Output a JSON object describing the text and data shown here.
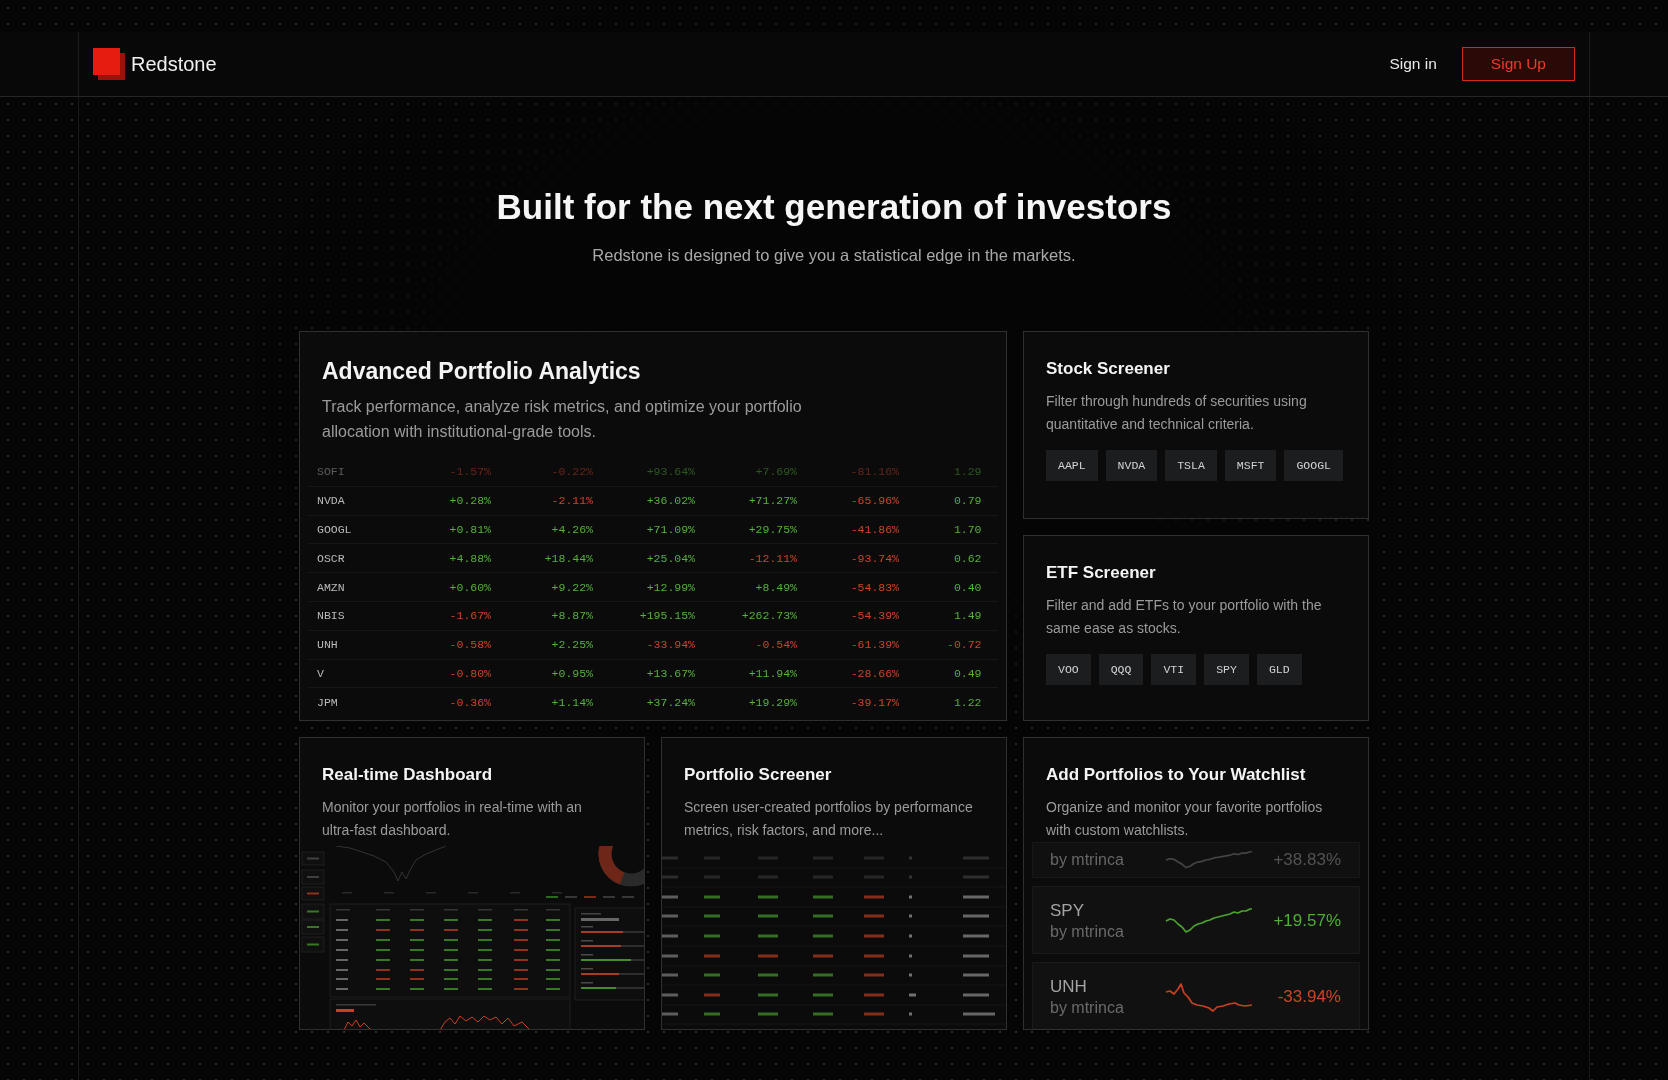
{
  "header": {
    "brand": "Redstone",
    "sign_in": "Sign in",
    "sign_up": "Sign Up"
  },
  "hero": {
    "title": "Built for the next generation of investors",
    "subtitle": "Redstone is designed to give you a statistical edge in the markets."
  },
  "features": [
    {
      "kind": "table",
      "title": "Advanced Portfolio Analytics",
      "description": "Track performance, analyze risk metrics, and optimize your portfolio allocation with institutional-grade tools.",
      "table": {
        "rows": [
          {
            "ticker": "SOFI",
            "values": [
              {
                "text": "-1.57%",
                "kind": "down"
              },
              {
                "text": "-0.22%",
                "kind": "down"
              },
              {
                "text": "+93.64%",
                "kind": "up"
              },
              {
                "text": "+7.69%",
                "kind": "up"
              },
              {
                "text": "-81.16%",
                "kind": "down"
              },
              {
                "text": "1.29",
                "kind": "up"
              }
            ]
          },
          {
            "ticker": "NVDA",
            "values": [
              {
                "text": "+0.28%",
                "kind": "up"
              },
              {
                "text": "-2.11%",
                "kind": "down"
              },
              {
                "text": "+36.02%",
                "kind": "up"
              },
              {
                "text": "+71.27%",
                "kind": "up"
              },
              {
                "text": "-65.96%",
                "kind": "down"
              },
              {
                "text": "0.79",
                "kind": "up"
              }
            ]
          },
          {
            "ticker": "GOOGL",
            "values": [
              {
                "text": "+0.81%",
                "kind": "up"
              },
              {
                "text": "+4.26%",
                "kind": "up"
              },
              {
                "text": "+71.09%",
                "kind": "up"
              },
              {
                "text": "+29.75%",
                "kind": "up"
              },
              {
                "text": "-41.86%",
                "kind": "down"
              },
              {
                "text": "1.70",
                "kind": "up"
              }
            ]
          },
          {
            "ticker": "OSCR",
            "values": [
              {
                "text": "+4.88%",
                "kind": "up"
              },
              {
                "text": "+18.44%",
                "kind": "up"
              },
              {
                "text": "+25.04%",
                "kind": "up"
              },
              {
                "text": "-12.11%",
                "kind": "down"
              },
              {
                "text": "-93.74%",
                "kind": "down"
              },
              {
                "text": "0.62",
                "kind": "up"
              }
            ]
          },
          {
            "ticker": "AMZN",
            "values": [
              {
                "text": "+0.60%",
                "kind": "up"
              },
              {
                "text": "+9.22%",
                "kind": "up"
              },
              {
                "text": "+12.99%",
                "kind": "up"
              },
              {
                "text": "+8.49%",
                "kind": "up"
              },
              {
                "text": "-54.83%",
                "kind": "down"
              },
              {
                "text": "0.40",
                "kind": "up"
              }
            ]
          },
          {
            "ticker": "NBIS",
            "values": [
              {
                "text": "-1.67%",
                "kind": "down"
              },
              {
                "text": "+8.87%",
                "kind": "up"
              },
              {
                "text": "+195.15%",
                "kind": "up"
              },
              {
                "text": "+262.73%",
                "kind": "up"
              },
              {
                "text": "-54.39%",
                "kind": "down"
              },
              {
                "text": "1.49",
                "kind": "up"
              }
            ]
          },
          {
            "ticker": "UNH",
            "values": [
              {
                "text": "-0.58%",
                "kind": "down"
              },
              {
                "text": "+2.25%",
                "kind": "up"
              },
              {
                "text": "-33.94%",
                "kind": "down"
              },
              {
                "text": "-0.54%",
                "kind": "down"
              },
              {
                "text": "-61.39%",
                "kind": "down"
              },
              {
                "text": "-0.72",
                "kind": "down"
              }
            ]
          },
          {
            "ticker": "V",
            "values": [
              {
                "text": "-0.80%",
                "kind": "down"
              },
              {
                "text": "+0.95%",
                "kind": "up"
              },
              {
                "text": "+13.67%",
                "kind": "up"
              },
              {
                "text": "+11.94%",
                "kind": "up"
              },
              {
                "text": "-28.66%",
                "kind": "down"
              },
              {
                "text": "0.49",
                "kind": "up"
              }
            ]
          },
          {
            "ticker": "JPM",
            "values": [
              {
                "text": "-0.36%",
                "kind": "down"
              },
              {
                "text": "+1.14%",
                "kind": "up"
              },
              {
                "text": "+37.24%",
                "kind": "up"
              },
              {
                "text": "+19.29%",
                "kind": "up"
              },
              {
                "text": "-39.17%",
                "kind": "down"
              },
              {
                "text": "1.22",
                "kind": "up"
              }
            ]
          }
        ]
      }
    },
    {
      "kind": "chips",
      "title": "Stock Screener",
      "description": "Filter through hundreds of securities using quantitative and technical criteria.",
      "chips": [
        "AAPL",
        "NVDA",
        "TSLA",
        "MSFT",
        "GOOGL"
      ]
    },
    {
      "kind": "chips",
      "title": "ETF Screener",
      "description": "Filter and add ETFs to your portfolio with the same ease as stocks.",
      "chips": [
        "VOO",
        "QQQ",
        "VTI",
        "SPY",
        "GLD"
      ]
    },
    {
      "kind": "dashboard",
      "title": "Real-time Dashboard",
      "description": "Monitor your portfolios in real-time with an ultra-fast dashboard."
    },
    {
      "kind": "screener",
      "title": "Portfolio Screener",
      "description": "Screen user-created portfolios by performance metrics, risk factors, and more..."
    },
    {
      "kind": "watchlist",
      "title": "Add Portfolios to Your Watchlist",
      "description": "Organize and monitor your favorite portfolios with custom watchlists.",
      "items": [
        {
          "owner": "by mtrinca",
          "change": "+38.83%",
          "kind": "up"
        },
        {
          "name": "SPY",
          "owner": "by mtrinca",
          "change": "+19.57%",
          "kind": "up"
        },
        {
          "name": "UNH",
          "owner": "by mtrinca",
          "change": "-33.94%",
          "kind": "down"
        }
      ]
    }
  ]
}
